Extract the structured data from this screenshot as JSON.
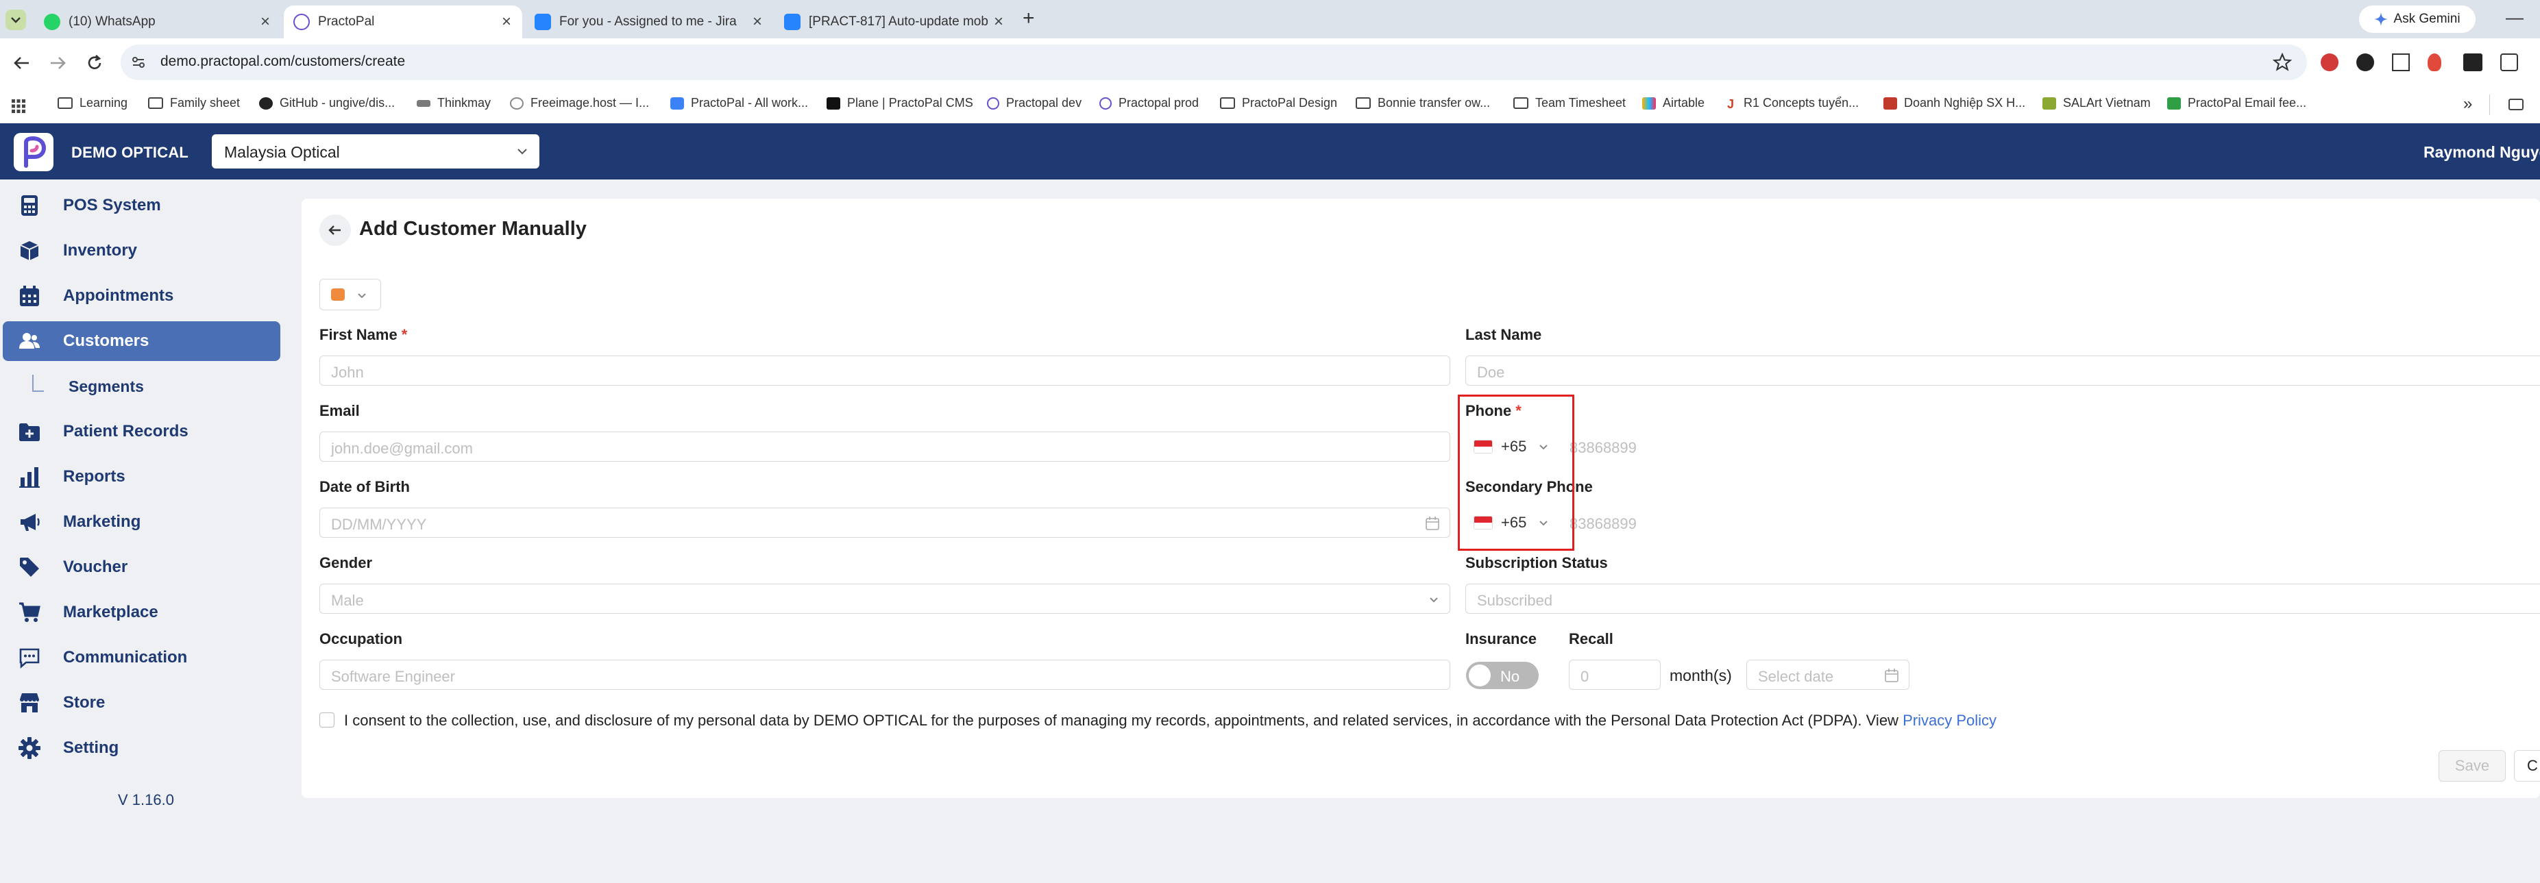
{
  "browser": {
    "tabs": [
      {
        "title": "(10) WhatsApp",
        "active": false
      },
      {
        "title": "PractoPal",
        "active": true
      },
      {
        "title": "For you - Assigned to me - Jira",
        "active": false
      },
      {
        "title": "[PRACT-817] Auto-update mob",
        "active": false
      }
    ],
    "new_tab_label": "+",
    "ask_gemini": "Ask Gemini",
    "url": "demo.practopal.com/customers/create",
    "bookmarks": [
      {
        "label": "Learning",
        "icon": "folder-icon"
      },
      {
        "label": "Family sheet",
        "icon": "folder-icon"
      },
      {
        "label": "GitHub - ungive/dis...",
        "icon": "github-icon"
      },
      {
        "label": "Thinkmay",
        "icon": "thinkmay-icon"
      },
      {
        "label": "Freeimage.host — I...",
        "icon": "freeimage-icon"
      },
      {
        "label": "PractoPal - All work...",
        "icon": "plane-icon"
      },
      {
        "label": "Plane | PractoPal CMS",
        "icon": "plane-cms-icon"
      },
      {
        "label": "Practopal dev",
        "icon": "practopal-icon"
      },
      {
        "label": "Practopal prod",
        "icon": "practopal-icon"
      },
      {
        "label": "PractoPal Design",
        "icon": "folder-icon"
      },
      {
        "label": "Bonnie transfer ow...",
        "icon": "folder-icon"
      },
      {
        "label": "Team Timesheet",
        "icon": "folder-icon"
      },
      {
        "label": "Airtable",
        "icon": "airtable-icon"
      },
      {
        "label": "R1 Concepts tuyển...",
        "icon": "r1-icon"
      },
      {
        "label": "Doanh Nghiệp SX H...",
        "icon": "doanh-nghiep-icon"
      },
      {
        "label": "SALArt Vietnam",
        "icon": "salart-icon"
      },
      {
        "label": "PractoPal Email fee...",
        "icon": "email-icon"
      }
    ]
  },
  "header": {
    "brand": "DEMO OPTICAL",
    "store": "Malaysia Optical",
    "user": "Raymond Nguyen"
  },
  "sidebar": {
    "items": [
      {
        "label": "POS System",
        "icon": "pos-icon"
      },
      {
        "label": "Inventory",
        "icon": "box-icon"
      },
      {
        "label": "Appointments",
        "icon": "calendar-icon"
      },
      {
        "label": "Customers",
        "icon": "users-icon",
        "active": true
      },
      {
        "label": "Segments",
        "sub": true
      },
      {
        "label": "Patient Records",
        "icon": "folder-plus-icon"
      },
      {
        "label": "Reports",
        "icon": "bar-chart-icon"
      },
      {
        "label": "Marketing",
        "icon": "megaphone-icon"
      },
      {
        "label": "Voucher",
        "icon": "tag-icon"
      },
      {
        "label": "Marketplace",
        "icon": "cart-icon"
      },
      {
        "label": "Communication",
        "icon": "chat-icon"
      },
      {
        "label": "Store",
        "icon": "store-icon"
      },
      {
        "label": "Setting",
        "icon": "gear-icon"
      }
    ],
    "version": "V 1.16.0"
  },
  "form": {
    "title": "Add Customer Manually",
    "tag_color": "#f08a3c",
    "first_name": {
      "label": "First Name",
      "required": "*",
      "placeholder": "John"
    },
    "last_name": {
      "label": "Last Name",
      "placeholder": "Doe"
    },
    "email": {
      "label": "Email",
      "placeholder": "john.doe@gmail.com"
    },
    "phone": {
      "label": "Phone",
      "required": "*",
      "code": "+65",
      "placeholder": "83868899"
    },
    "dob": {
      "label": "Date of Birth",
      "placeholder": "DD/MM/YYYY"
    },
    "secondary_phone": {
      "label": "Secondary Phone",
      "code": "+65",
      "placeholder": "83868899"
    },
    "gender": {
      "label": "Gender",
      "value": "Male"
    },
    "subscription": {
      "label": "Subscription Status",
      "value": "Subscribed"
    },
    "occupation": {
      "label": "Occupation",
      "placeholder": "Software Engineer"
    },
    "insurance": {
      "label": "Insurance",
      "toggle_text": "No"
    },
    "recall": {
      "label": "Recall",
      "placeholder": "0",
      "unit": "month(s)",
      "date_placeholder": "Select date"
    },
    "consent": {
      "text": "I consent to the collection, use, and disclosure of my personal data by DEMO OPTICAL for the purposes of managing my records, appointments, and related services, in accordance with the Personal Data Protection Act (PDPA). View",
      "link": "Privacy Policy"
    },
    "save_label": "Save",
    "cancel_label": "C"
  },
  "colors": {
    "header_bg": "#1f3a73",
    "active_nav": "#4a6fb5",
    "required": "#e03c31",
    "link": "#3b6fd6",
    "highlight_box": "#e02020"
  }
}
